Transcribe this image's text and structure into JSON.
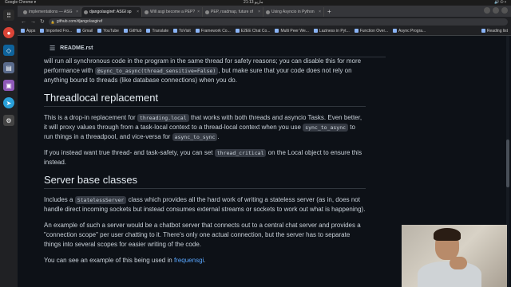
{
  "system": {
    "app_name": "Google Chrome ▾",
    "clock": "21:13 ماريو",
    "status_icons": "🔊 ⏻ ▾"
  },
  "tabs": [
    {
      "label": "implementations — ASG",
      "active": false
    },
    {
      "label": "django/asgiref: ASGI sp",
      "active": true
    },
    {
      "label": "Will asgi become a PEP?",
      "active": false
    },
    {
      "label": "PEP, roadmap, future of",
      "active": false
    },
    {
      "label": "Using Asyncio in Python",
      "active": false
    }
  ],
  "new_tab_label": "+",
  "omnibox": {
    "url": "github.com/django/asgiref",
    "back": "←",
    "forward": "→",
    "reload": "↻"
  },
  "bookmarks": [
    "Apps",
    "Imported Fro...",
    "Gmail",
    "YouTube",
    "GitHub",
    "Translate",
    "ToVisit",
    "Framework Co...",
    "E2EE Chat Co...",
    "Multi Peer We...",
    "Laziness in Pyt...",
    "Function Over...",
    "Async Progra..."
  ],
  "reading_list": "Reading list",
  "readme": {
    "menu_icon": "☰",
    "filename": "README.rst"
  },
  "content": {
    "p0_a": "will run all synchronous code in the program in the same thread for safety reasons; you can disable this for more performance with ",
    "p0_code": "@sync_to_async(thread_sensitive=False)",
    "p0_b": ", but make sure that your code does not rely on anything bound to threads (like database connections) when you do.",
    "h_threadlocal": "Threadlocal replacement",
    "p1_a": "This is a drop-in replacement for ",
    "p1_code1": "threading.local",
    "p1_b": " that works with both threads and asyncio Tasks. Even better, it will proxy values through from a task-local context to a thread-local context when you use ",
    "p1_code2": "sync_to_async",
    "p1_c": " to run things in a threadpool, and vice-versa for ",
    "p1_code3": "async_to_sync",
    "p1_d": ".",
    "p2_a": "If you instead want true thread- and task-safety, you can set ",
    "p2_code": "thread_critical",
    "p2_b": " on the Local object to ensure this instead.",
    "h_server": "Server base classes",
    "p3_a": "Includes a ",
    "p3_code": "StatelessServer",
    "p3_b": " class which provides all the hard work of writing a stateless server (as in, does not handle direct incoming sockets but instead consumes external streams or sockets to work out what is happening).",
    "p4": "An example of such a server would be a chatbot server that connects out to a central chat server and provides a \"connection scope\" per user chatting to it. There's only one actual connection, but the server has to separate things into several scopes for easier writing of the code.",
    "p5_a": "You can see an example of this being used in ",
    "p5_link": "frequensgi",
    "p5_b": "."
  },
  "colors": {
    "bg": "#0d1117",
    "text": "#c9d1d9",
    "link": "#58a6ff",
    "code_bg": "#343942"
  }
}
